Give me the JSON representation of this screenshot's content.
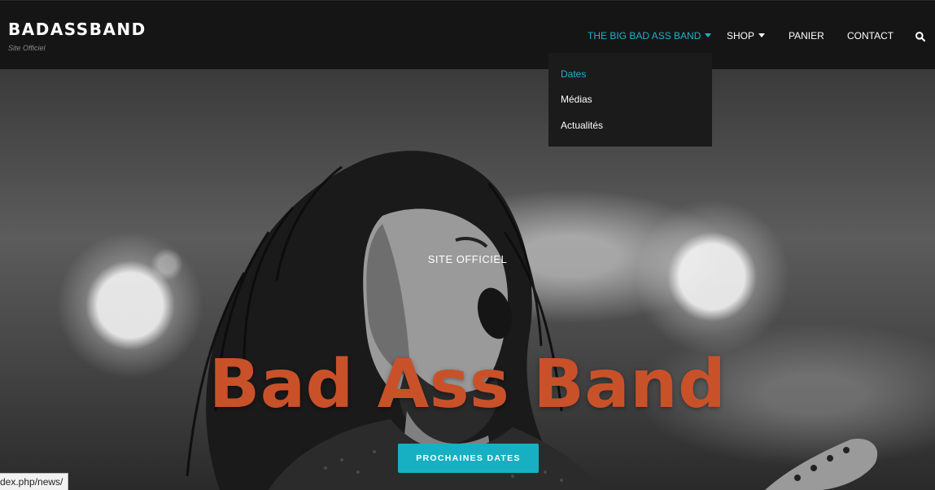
{
  "header": {
    "brand": "BADASSBAND",
    "tagline": "Site Officiel"
  },
  "nav": {
    "items": [
      {
        "label": "THE BIG BAD ASS BAND",
        "has_caret": true,
        "active": true
      },
      {
        "label": "SHOP",
        "has_caret": true,
        "active": false
      },
      {
        "label": "PANIER",
        "has_caret": false,
        "active": false
      },
      {
        "label": "CONTACT",
        "has_caret": false,
        "active": false
      }
    ],
    "search_icon": "search-icon"
  },
  "dropdown": {
    "items": [
      {
        "label": "Dates",
        "current": true
      },
      {
        "label": "Médias",
        "current": false
      },
      {
        "label": "Actualités",
        "current": false
      }
    ]
  },
  "hero": {
    "subtitle": "SITE OFFICIEL",
    "title": "Bad Ass Band",
    "cta_label": "PROCHAINES DATES",
    "image_description_icon": "singer-photo"
  },
  "status_bar": {
    "url": "dex.php/news/"
  },
  "colors": {
    "accent": "#1fb1c9",
    "cta": "#17b0c2",
    "title": "#c9512a",
    "header_bg": "#151515",
    "dropdown_bg": "#1b1b1b"
  }
}
